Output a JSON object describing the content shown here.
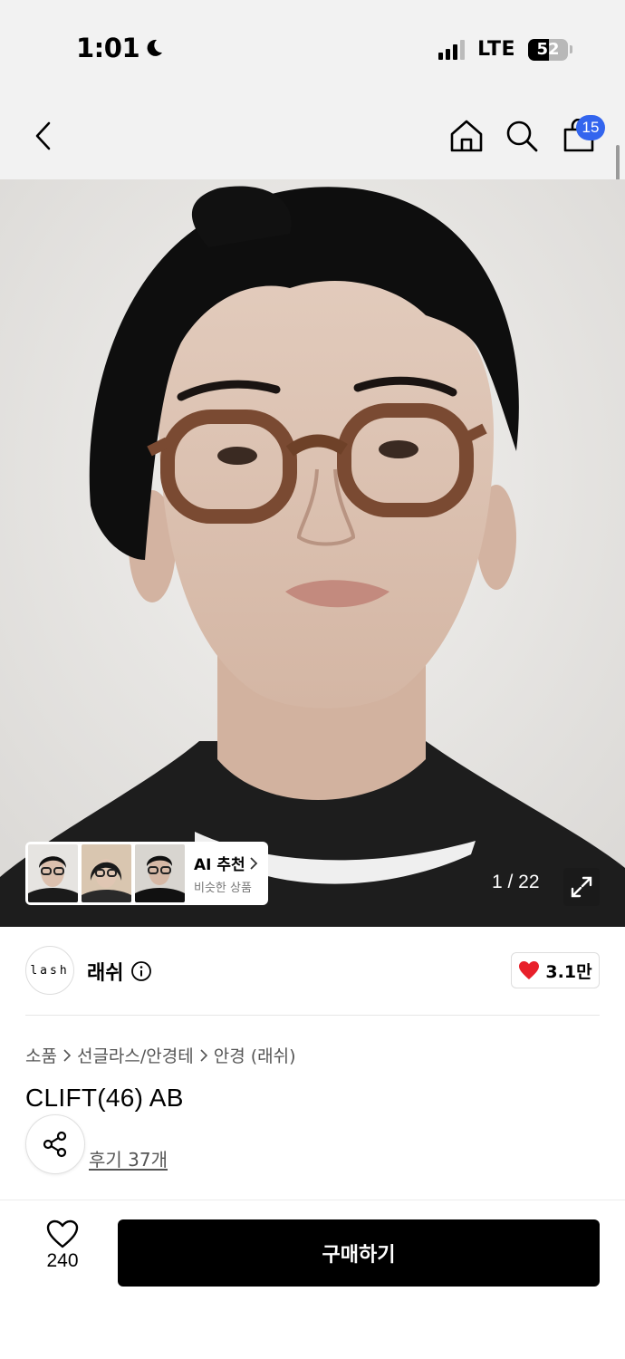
{
  "status_bar": {
    "time": "1:01",
    "network": "LTE",
    "battery": "52",
    "battery_level": 0.52
  },
  "nav": {
    "cart_count": "15"
  },
  "gallery": {
    "counter": "1 / 22",
    "ai_card": {
      "title": "AI 추천",
      "subtitle": "비슷한 상품"
    }
  },
  "brand": {
    "logo_text": "lash",
    "name": "래쉬",
    "likes": "3.1만"
  },
  "breadcrumb": [
    "소품",
    "선글라스/안경테",
    "안경 (래쉬)"
  ],
  "product": {
    "title": "CLIFT(46) AB",
    "reviews": "후기 37개"
  },
  "bottom_bar": {
    "wish_count": "240",
    "buy_label": "구매하기"
  },
  "colors": {
    "accent": "#3365ee",
    "heart": "#e8202a",
    "buy_button": "#000000"
  }
}
